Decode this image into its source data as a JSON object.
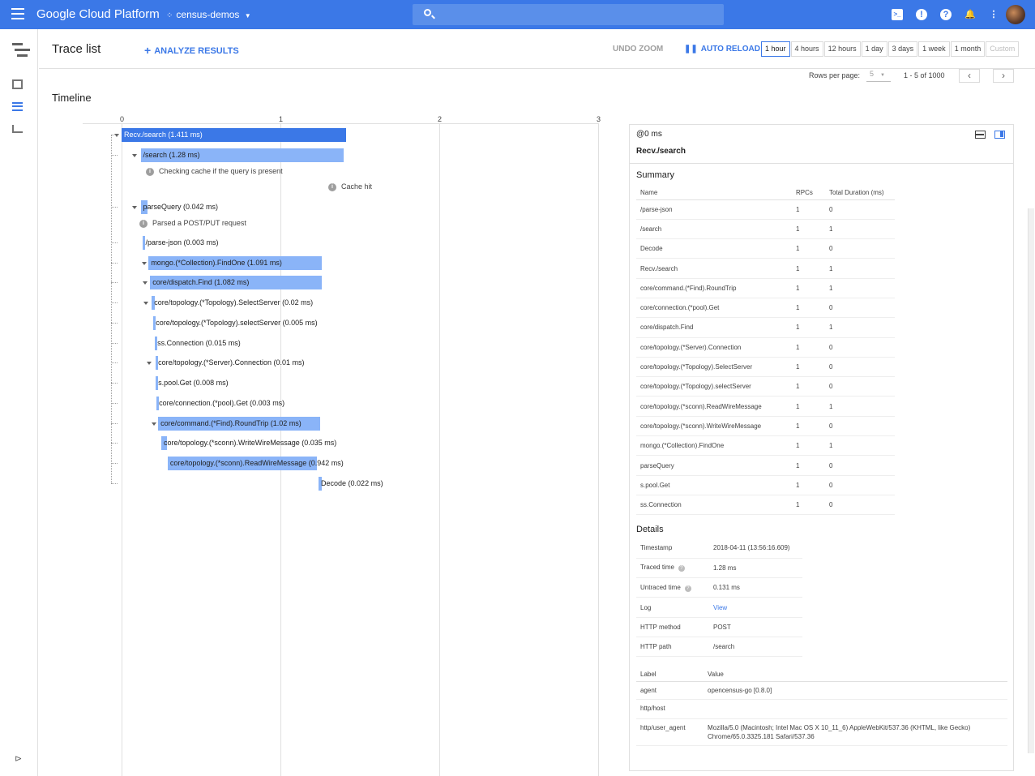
{
  "topbar": {
    "brand": "Google Cloud Platform",
    "project": "census-demos",
    "icons": [
      "menu-icon",
      "project-icon",
      "chevron-down-icon",
      "search-icon",
      "cloud-shell-icon",
      "alert-icon",
      "help-icon",
      "notifications-icon",
      "more-vert-icon",
      "avatar"
    ]
  },
  "header": {
    "title": "Trace list",
    "analyze_label": "ANALYZE RESULTS",
    "undo_zoom": "UNDO ZOOM",
    "auto_reload": "AUTO RELOAD",
    "ranges": [
      "1 hour",
      "4 hours",
      "12 hours",
      "1 day",
      "3 days",
      "1 week",
      "1 month",
      "Custom"
    ],
    "selected_range": "1 hour"
  },
  "pager": {
    "rows_label": "Rows per page:",
    "rows_value": "5",
    "count": "1 - 5 of 1000"
  },
  "timeline": {
    "title": "Timeline",
    "ticks": [
      "0",
      "1",
      "2",
      "3"
    ],
    "spans": [
      {
        "label": "Recv./search (1.411 ms)",
        "start_ms": 0.0,
        "dur_ms": 1.411,
        "depth": 0
      },
      {
        "label": "/search (1.28 ms)",
        "start_ms": 0.12,
        "dur_ms": 1.28,
        "depth": 1
      },
      {
        "label": "parseQuery (0.042 ms)",
        "start_ms": 0.12,
        "dur_ms": 0.042,
        "depth": 1
      },
      {
        "label": "/parse-json (0.003 ms)",
        "start_ms": 0.135,
        "dur_ms": 0.003,
        "depth": 2
      },
      {
        "label": "mongo.(*Collection).FindOne (1.091 ms)",
        "start_ms": 0.17,
        "dur_ms": 1.091,
        "depth": 2
      },
      {
        "label": "core/dispatch.Find (1.082 ms)",
        "start_ms": 0.18,
        "dur_ms": 1.082,
        "depth": 3
      },
      {
        "label": "core/topology.(*Topology).SelectServer (0.02 ms)",
        "start_ms": 0.19,
        "dur_ms": 0.02,
        "depth": 4
      },
      {
        "label": "core/topology.(*Topology).selectServer (0.005 ms)",
        "start_ms": 0.2,
        "dur_ms": 0.005,
        "depth": 5
      },
      {
        "label": "ss.Connection (0.015 ms)",
        "start_ms": 0.21,
        "dur_ms": 0.015,
        "depth": 5
      },
      {
        "label": "core/topology.(*Server).Connection (0.01 ms)",
        "start_ms": 0.215,
        "dur_ms": 0.01,
        "depth": 6
      },
      {
        "label": "s.pool.Get (0.008 ms)",
        "start_ms": 0.215,
        "dur_ms": 0.008,
        "depth": 6
      },
      {
        "label": "core/connection.(*pool).Get (0.003 ms)",
        "start_ms": 0.22,
        "dur_ms": 0.003,
        "depth": 7
      },
      {
        "label": "core/command.(*Find).RoundTrip (1.02 ms)",
        "start_ms": 0.23,
        "dur_ms": 1.02,
        "depth": 4
      },
      {
        "label": "core/topology.(*sconn).WriteWireMessage (0.035 ms)",
        "start_ms": 0.25,
        "dur_ms": 0.035,
        "depth": 5
      },
      {
        "label": "core/topology.(*sconn).ReadWireMessage (0.942 ms)",
        "start_ms": 0.29,
        "dur_ms": 0.942,
        "depth": 5
      },
      {
        "label": "Decode (0.022 ms)",
        "start_ms": 1.24,
        "dur_ms": 0.022,
        "depth": 5
      }
    ],
    "annotations": [
      {
        "text": "Checking cache if the query is present"
      },
      {
        "text": "Cache hit"
      },
      {
        "text": "Parsed a POST/PUT request"
      }
    ]
  },
  "panel": {
    "at": "@0 ms",
    "name": "Recv./search",
    "summary_title": "Summary",
    "summary_headers": [
      "Name",
      "RPCs",
      "Total Duration (ms)"
    ],
    "summary_rows": [
      [
        "/parse-json",
        "1",
        "0"
      ],
      [
        "/search",
        "1",
        "1"
      ],
      [
        "Decode",
        "1",
        "0"
      ],
      [
        "Recv./search",
        "1",
        "1"
      ],
      [
        "core/command.(*Find).RoundTrip",
        "1",
        "1"
      ],
      [
        "core/connection.(*pool).Get",
        "1",
        "0"
      ],
      [
        "core/dispatch.Find",
        "1",
        "1"
      ],
      [
        "core/topology.(*Server).Connection",
        "1",
        "0"
      ],
      [
        "core/topology.(*Topology).SelectServer",
        "1",
        "0"
      ],
      [
        "core/topology.(*Topology).selectServer",
        "1",
        "0"
      ],
      [
        "core/topology.(*sconn).ReadWireMessage",
        "1",
        "1"
      ],
      [
        "core/topology.(*sconn).WriteWireMessage",
        "1",
        "0"
      ],
      [
        "mongo.(*Collection).FindOne",
        "1",
        "1"
      ],
      [
        "parseQuery",
        "1",
        "0"
      ],
      [
        "s.pool.Get",
        "1",
        "0"
      ],
      [
        "ss.Connection",
        "1",
        "0"
      ]
    ],
    "details_title": "Details",
    "details": [
      {
        "k": "Timestamp",
        "v": "2018-04-11 (13:56:16.609)"
      },
      {
        "k": "Traced time",
        "v": "1.28 ms"
      },
      {
        "k": "Untraced time",
        "v": "0.131 ms"
      },
      {
        "k": "Log",
        "v": "View"
      },
      {
        "k": "HTTP method",
        "v": "POST"
      },
      {
        "k": "HTTP path",
        "v": "/search"
      }
    ],
    "label_headers": [
      "Label",
      "Value"
    ],
    "labels": [
      {
        "k": "agent",
        "v": "opencensus-go [0.8.0]"
      },
      {
        "k": "http/host",
        "v": ""
      },
      {
        "k": "http/user_agent",
        "v": "Mozilla/5.0 (Macintosh; Intel Mac OS X 10_11_6) AppleWebKit/537.36 (KHTML, like Gecko) Chrome/65.0.3325.181 Safari/537.36"
      }
    ]
  },
  "colors": {
    "brand": "#3b78e7",
    "bar_root": "#3b78e7",
    "bar_child": "#8ab4f8"
  }
}
